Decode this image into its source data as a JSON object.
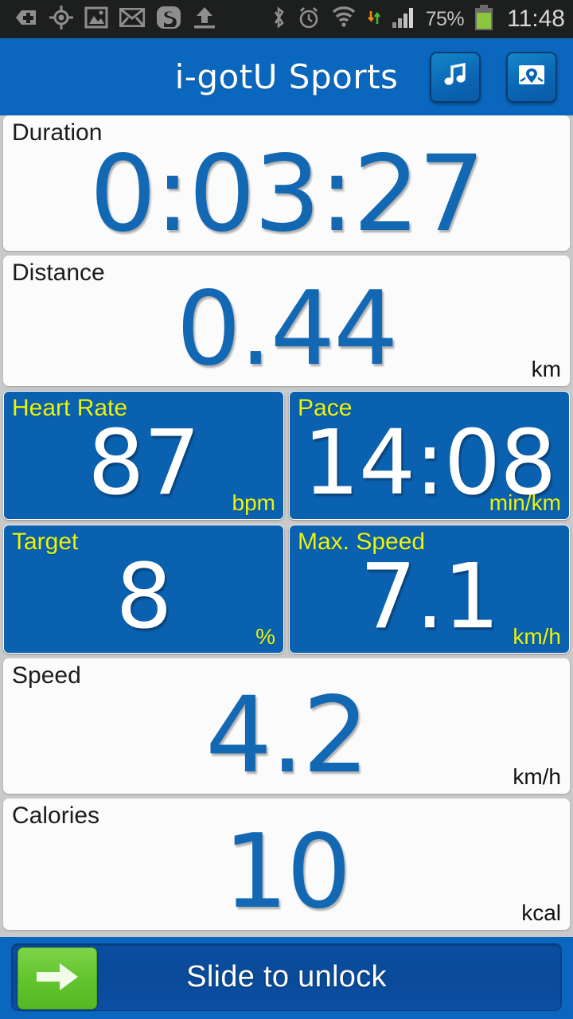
{
  "statusbar": {
    "icons_left": [
      "add-tag-icon",
      "gps-crosshair-icon",
      "screenshot-image-icon",
      "email-envelope-icon",
      "skype-icon",
      "upload-arrow-icon"
    ],
    "icons_right": [
      "bluetooth-icon",
      "alarm-clock-icon",
      "wifi-icon",
      "data-transfer-icon",
      "signal-bars-icon"
    ],
    "battery_percent": "75%",
    "clock": "11:48"
  },
  "header": {
    "title": "i-gotU Sports",
    "buttons": [
      {
        "name": "music-button",
        "icon": "music-note-icon"
      },
      {
        "name": "map-button",
        "icon": "map-pin-icon"
      }
    ]
  },
  "metrics": {
    "duration": {
      "label": "Duration",
      "value": "0:03:27",
      "unit": ""
    },
    "distance": {
      "label": "Distance",
      "value": "0.44",
      "unit": "km"
    },
    "heartrate": {
      "label": "Heart Rate",
      "value": "87",
      "unit": "bpm"
    },
    "pace": {
      "label": "Pace",
      "value": "14:08",
      "unit": "min/km"
    },
    "target": {
      "label": "Target",
      "value": "8",
      "unit": "%"
    },
    "maxspeed": {
      "label": "Max. Speed",
      "value": "7.1",
      "unit": "km/h"
    },
    "speed": {
      "label": "Speed",
      "value": "4.2",
      "unit": "km/h"
    },
    "calories": {
      "label": "Calories",
      "value": "10",
      "unit": "kcal"
    }
  },
  "unlock": {
    "text": "Slide to unlock",
    "handle_icon": "arrow-right-icon"
  },
  "colors": {
    "header_blue": "#0a67bd",
    "panel_blue": "#0a61b0",
    "value_blue": "#1268b3",
    "label_yellow": "#eaf40c",
    "handle_green": "#64c52f",
    "background_gray": "#c9c9c9"
  }
}
